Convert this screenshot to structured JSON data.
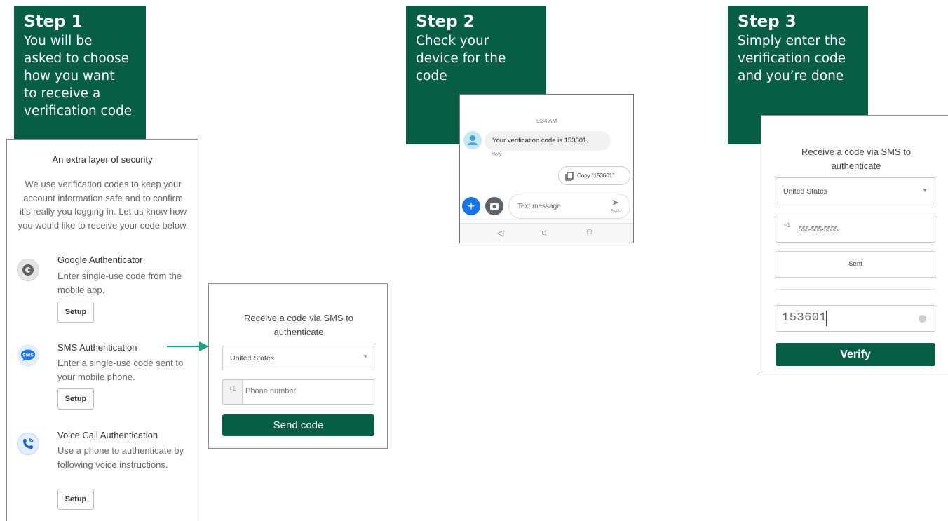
{
  "steps": [
    {
      "title": "Step 1",
      "desc": "You will be\nasked to choose\nhow you want\nto receive a\nverification code"
    },
    {
      "title": "Step 2",
      "desc": "Check your\ndevice for the\ncode"
    },
    {
      "title": "Step 3",
      "desc": "Simply enter the\nverification code\nand you’re done"
    }
  ],
  "security": {
    "title": "An extra layer of security",
    "intro": "We use verification codes to keep your account information safe and to confirm it's really you logging in. Let us know how you would like to receive your code below.",
    "methods": [
      {
        "name": "Google Authenticator",
        "desc": "Enter single-use code from the mobile app.",
        "button": "Setup",
        "icon": "google-authenticator-icon"
      },
      {
        "name": "SMS Authentication",
        "desc": "Enter a single-use code sent to your mobile phone.",
        "button": "Setup",
        "icon": "sms-icon",
        "icon_text": "SMS"
      },
      {
        "name": "Voice Call Authentication",
        "desc": "Use a phone to authenticate by following voice instructions.",
        "button": "Setup",
        "icon": "phone-icon"
      }
    ]
  },
  "sms_form": {
    "title": "Receive a code via SMS to authenticate",
    "country": "United States",
    "prefix": "+1",
    "phone_placeholder": "Phone number",
    "button": "Send code"
  },
  "phone": {
    "time": "9:34 AM",
    "message": "Your verification code is 153601.",
    "message_time": "Now",
    "copy_label": "Copy “153601”",
    "input_placeholder": "Text message",
    "send_label": "SMS"
  },
  "verify_form": {
    "title": "Receive a code via SMS to authenticate",
    "country": "United States",
    "prefix": "+1",
    "phone": "555-555-5555",
    "sent_button": "Sent",
    "code": "153601",
    "verify_button": "Verify"
  },
  "colors": {
    "brand_green": "#075e45",
    "arrow_teal": "#1f9e84",
    "sms_blue": "#1a73e8"
  }
}
